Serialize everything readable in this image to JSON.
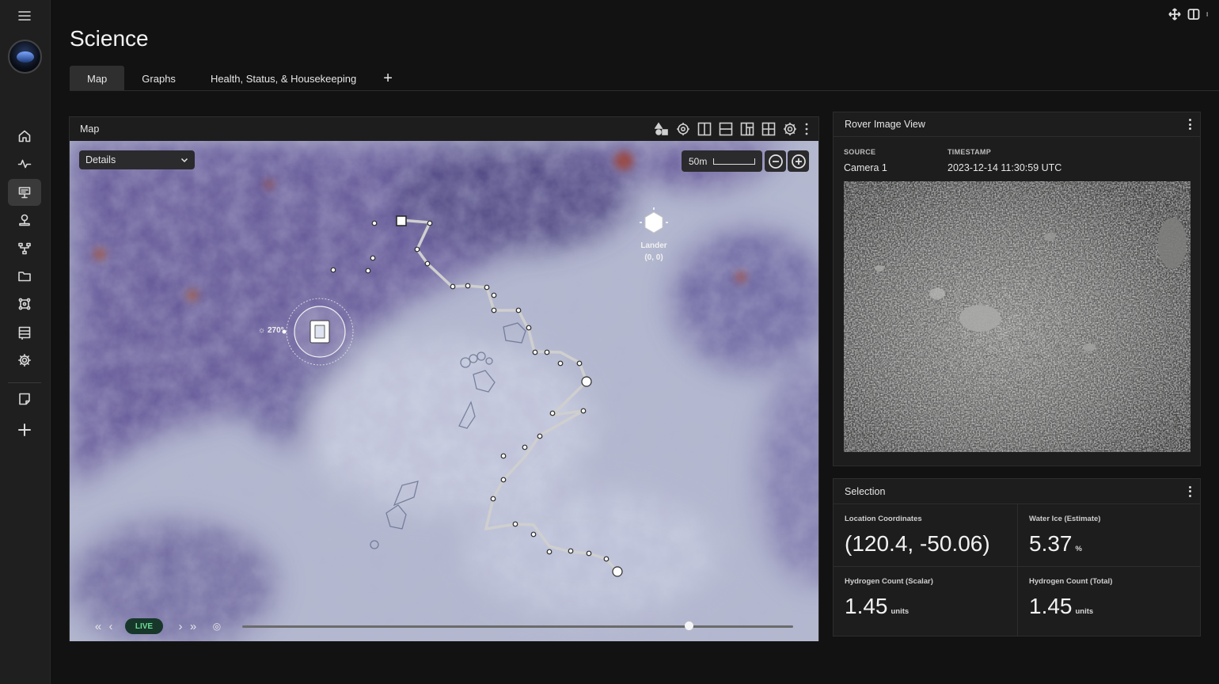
{
  "page": {
    "title": "Science"
  },
  "tabs": [
    {
      "label": "Map",
      "active": true
    },
    {
      "label": "Graphs",
      "active": false
    },
    {
      "label": "Health, Status, & Housekeeping",
      "active": false
    }
  ],
  "tab_add": "+",
  "sidebar": {
    "items": [
      {
        "icon": "home-icon"
      },
      {
        "icon": "activity-icon"
      },
      {
        "icon": "presentation-icon",
        "active": true
      },
      {
        "icon": "map-pin-icon"
      },
      {
        "icon": "network-icon"
      },
      {
        "icon": "folder-icon"
      },
      {
        "icon": "nodes-icon"
      },
      {
        "icon": "form-icon"
      },
      {
        "icon": "gear-icon"
      },
      {
        "icon": "note-icon"
      },
      {
        "icon": "plus-icon"
      }
    ]
  },
  "map": {
    "panel_title": "Map",
    "layer_select": "Details",
    "scale_label": "50m",
    "lander": {
      "name": "Lander",
      "coords": "(0, 0)"
    },
    "rover_heading": "270°",
    "timeline": {
      "live_label": "LIVE",
      "position": 0.81
    },
    "colors": {
      "path": "#c9c9c9",
      "terrain_dark": "#5b4f8c",
      "terrain_light": "#b9c0d4"
    }
  },
  "rover_view": {
    "title": "Rover Image View",
    "source_label": "SOURCE",
    "source_value": "Camera 1",
    "timestamp_label": "TIMESTAMP",
    "timestamp_value": "2023-12-14 11:30:59 UTC"
  },
  "selection": {
    "title": "Selection",
    "cells": [
      {
        "label": "Location Coordinates",
        "value": "(120.4, -50.06)",
        "unit": ""
      },
      {
        "label": "Water Ice (Estimate)",
        "value": "5.37",
        "unit": "%"
      },
      {
        "label": "Hydrogen Count (Scalar)",
        "value": "1.45",
        "unit": "units"
      },
      {
        "label": "Hydrogen Count (Total)",
        "value": "1.45",
        "unit": "units"
      }
    ]
  }
}
